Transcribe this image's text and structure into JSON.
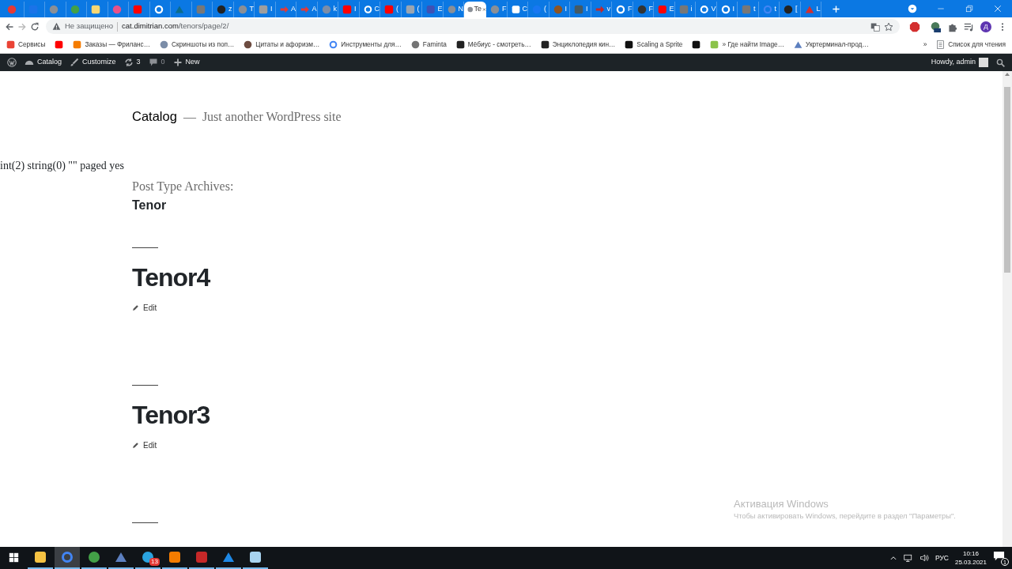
{
  "browser": {
    "tabs": [
      {
        "kind": "note",
        "selected": false
      },
      {
        "kind": "gsq",
        "selected": false
      },
      {
        "kind": "dot",
        "selected": false
      },
      {
        "kind": "green",
        "selected": false
      },
      {
        "kind": "sticky",
        "selected": false
      },
      {
        "kind": "ball",
        "selected": false
      },
      {
        "kind": "play",
        "selected": false
      },
      {
        "kind": "wp",
        "selected": false
      },
      {
        "kind": "vmark",
        "selected": false
      },
      {
        "kind": "ww",
        "selected": false
      },
      {
        "kind": "gh",
        "label": "z",
        "selected": false
      },
      {
        "kind": "dot",
        "label": "T",
        "selected": false
      },
      {
        "kind": "n36",
        "label": "I",
        "selected": false
      },
      {
        "kind": "arrow",
        "label": "A",
        "selected": false
      },
      {
        "kind": "arrow",
        "label": "A",
        "selected": false
      },
      {
        "kind": "globe",
        "label": "k",
        "selected": false
      },
      {
        "kind": "play",
        "label": "I",
        "selected": false
      },
      {
        "kind": "oring",
        "label": "C",
        "selected": false
      },
      {
        "kind": "play",
        "label": "(",
        "selected": false
      },
      {
        "kind": "jbar",
        "label": "(",
        "selected": false
      },
      {
        "kind": "fsq",
        "label": "E",
        "selected": false
      },
      {
        "kind": "dot",
        "label": "N",
        "selected": false
      },
      {
        "kind": "dot",
        "label": "Te",
        "selected": true
      },
      {
        "kind": "dot",
        "label": "F",
        "selected": false
      },
      {
        "kind": "grid",
        "label": "C",
        "selected": false
      },
      {
        "kind": "fcirc",
        "label": "(",
        "selected": false
      },
      {
        "kind": "brown",
        "label": "I",
        "selected": false
      },
      {
        "kind": "psq",
        "label": "I",
        "selected": false
      },
      {
        "kind": "code",
        "label": "v",
        "selected": false
      },
      {
        "kind": "wp",
        "label": "F",
        "selected": false
      },
      {
        "kind": "tcirc",
        "label": "F",
        "selected": false
      },
      {
        "kind": "play",
        "label": "E",
        "selected": false
      },
      {
        "kind": "ww",
        "label": "i",
        "selected": false
      },
      {
        "kind": "wp",
        "label": "V",
        "selected": false
      },
      {
        "kind": "wp",
        "label": "I",
        "selected": false
      },
      {
        "kind": "ww",
        "label": "t",
        "selected": false
      },
      {
        "kind": "gcolor",
        "label": "t",
        "selected": false
      },
      {
        "kind": "gh",
        "label": "[",
        "selected": false
      },
      {
        "kind": "chart",
        "label": "L",
        "selected": false
      }
    ],
    "address_bar": {
      "security": "Не защищено",
      "host": "cat.dimitrian.com",
      "path": "/tenors/page/2/"
    },
    "profile_initial": "Д",
    "bookmarks": [
      {
        "kind": "apps",
        "label": "Сервисы"
      },
      {
        "kind": "play"
      },
      {
        "kind": "orange",
        "label": "Заказы — Фриланс…"
      },
      {
        "kind": "globe",
        "label": "Скриншоты из поп…"
      },
      {
        "kind": "person",
        "label": "Цитаты и афоризм…"
      },
      {
        "kind": "gcolor",
        "label": "Инструменты для…"
      },
      {
        "kind": "cat",
        "label": "Faminta"
      },
      {
        "kind": "tv",
        "label": "Мёбиус - смотреть…"
      },
      {
        "kind": "tv",
        "label": "Энциклопедия кин…"
      },
      {
        "kind": "msq",
        "label": "Scaling a Sprite"
      },
      {
        "kind": "msq"
      },
      {
        "kind": "chat",
        "label": "» Где найти Image…"
      },
      {
        "kind": "tri",
        "label": "Укртерминал-прод…"
      }
    ],
    "bookmarks_more": "»",
    "reading_list": "Список для чтения"
  },
  "admin_bar": {
    "items": [
      {
        "kind": "logo"
      },
      {
        "kind": "dashboard",
        "label": "Catalog"
      },
      {
        "kind": "brush",
        "label": "Customize"
      },
      {
        "kind": "updates",
        "label": "3"
      },
      {
        "kind": "comments",
        "label": "0"
      },
      {
        "kind": "plus",
        "label": "New"
      }
    ],
    "greeting": "Howdy, admin"
  },
  "page": {
    "site_title": "Catalog",
    "separator": "—",
    "tagline": "Just another WordPress site",
    "debug_output": "int(2) string(0) \"\" paged yes",
    "archive_label": "Post Type Archives:",
    "archive_title": "Tenor",
    "posts": [
      {
        "title": "Tenor4",
        "edit": "Edit"
      },
      {
        "title": "Tenor3",
        "edit": "Edit"
      }
    ]
  },
  "activation_notice": {
    "title": "Активация Windows",
    "text": "Чтобы активировать Windows, перейдите в раздел \"Параметры\"."
  },
  "taskbar": {
    "apps": [
      {
        "kind": "folder",
        "selected": false
      },
      {
        "kind": "gcolor",
        "selected": true
      },
      {
        "kind": "green",
        "selected": false
      },
      {
        "kind": "tri",
        "selected": false
      },
      {
        "kind": "tg",
        "badge": "13",
        "selected": false
      },
      {
        "kind": "orange",
        "selected": false
      },
      {
        "kind": "redsq",
        "selected": false
      },
      {
        "kind": "bluesq",
        "selected": false
      },
      {
        "kind": "lightsq",
        "selected": false
      }
    ],
    "language": "РУС",
    "time": "10:16",
    "date": "25.03.2021",
    "notifications": "1"
  }
}
